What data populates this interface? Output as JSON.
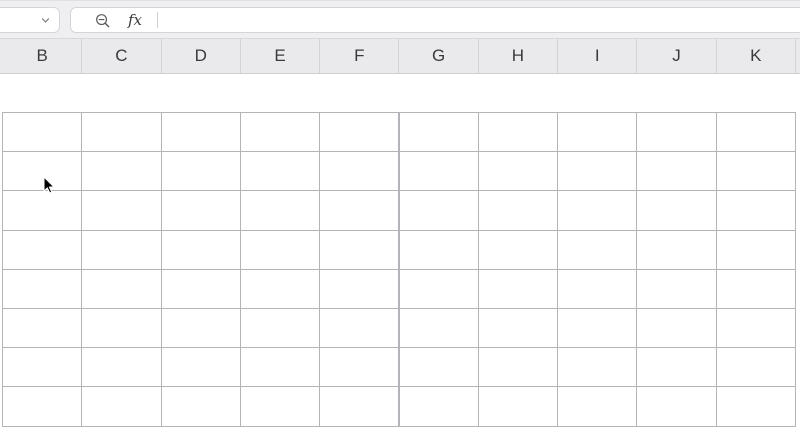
{
  "formula_bar": {
    "name_box_value": "",
    "fx_label": "fx",
    "formula_value": "",
    "icons": [
      "chevron-down-icon",
      "zoom-out-icon",
      "fx-icon"
    ]
  },
  "columns": [
    "B",
    "C",
    "D",
    "E",
    "F",
    "G",
    "H",
    "I",
    "J",
    "K"
  ],
  "grid": {
    "visible_rows": 8,
    "cells": "empty"
  },
  "colors": {
    "toolbar_bg": "#efeff1",
    "header_bg": "#eaeaec",
    "grid_line": "#b4b4b8"
  }
}
